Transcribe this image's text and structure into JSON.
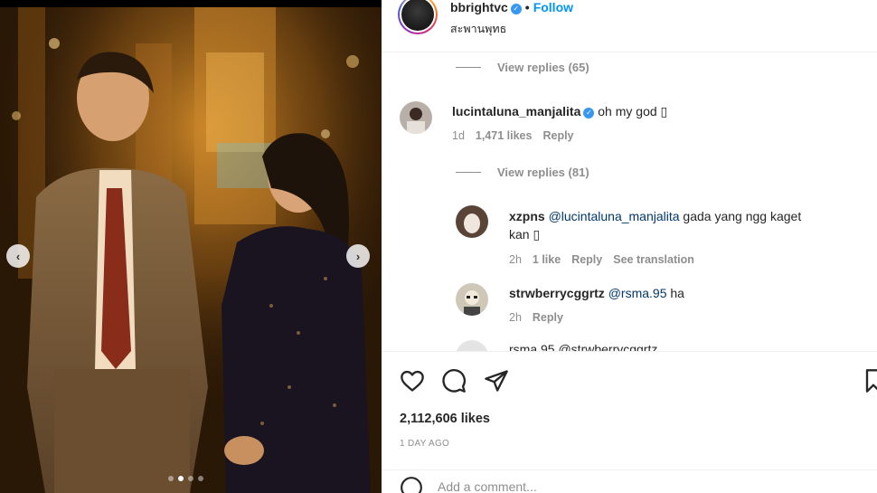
{
  "post": {
    "username": "bbrightvc",
    "separator": "•",
    "follow_label": "Follow",
    "location": "สะพานพุทธ"
  },
  "carousel": {
    "prev_glyph": "‹",
    "next_glyph": "›",
    "dot_count": 4,
    "active_dot": 2
  },
  "comments": {
    "view_replies_1": "View replies (65)",
    "main": {
      "username": "lucintaluna_manjalita",
      "text": "oh my god",
      "emoji": "▯",
      "time": "1d",
      "likes": "1,471 likes",
      "reply": "Reply"
    },
    "view_replies_2": "View replies (81)",
    "replies": [
      {
        "username": "xzpns",
        "mention": "@lucintaluna_manjalita",
        "text_1": " gada yang ngg kaget",
        "text_2": "kan",
        "emoji": "▯",
        "time": "2h",
        "likes": "1 like",
        "reply": "Reply",
        "translate": "See translation"
      },
      {
        "username": "strwberrycggrtz",
        "mention": "@rsma.95",
        "text": " ha",
        "time": "2h",
        "reply": "Reply"
      }
    ],
    "partial": "rsma.95 @strwberrycggrtz"
  },
  "actions": {
    "likes": "2,112,606 likes",
    "date": "1 DAY AGO",
    "add_comment_placeholder": "Add a comment..."
  },
  "icons": {
    "heart": "heart-icon",
    "comment": "comment-icon",
    "share": "share-icon",
    "save": "bookmark-icon",
    "verified": "verified-badge-icon",
    "emoji": "emoji-icon"
  },
  "colors": {
    "link_blue": "#0095f6",
    "verified_blue": "#3897f0",
    "mention": "#00376b",
    "muted": "#8e8e8e"
  }
}
